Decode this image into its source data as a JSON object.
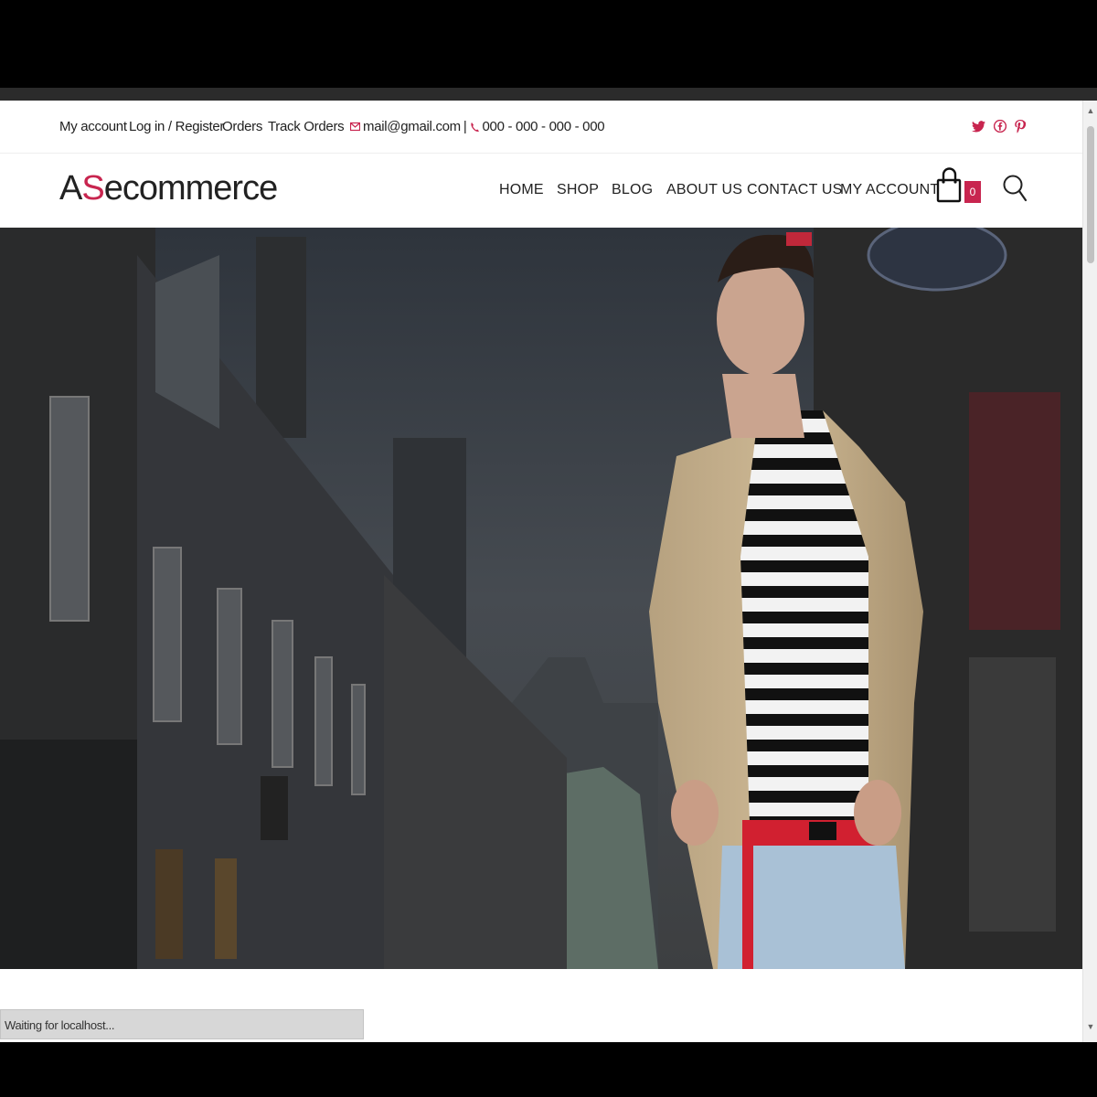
{
  "topbar": {
    "links": [
      "My account",
      "Log in / Register",
      "Orders",
      "Track Orders"
    ],
    "email": "mail@gmail.com",
    "separator": "|",
    "phone": "000 - 000 - 000 - 000",
    "social": [
      "twitter-icon",
      "facebook-icon",
      "pinterest-icon"
    ]
  },
  "header": {
    "logo_a": "A",
    "logo_s": "S",
    "logo_rest": "ecommerce",
    "nav": [
      "HOME",
      "SHOP",
      "BLOG",
      "ABOUT US",
      "CONTACT US",
      "MY ACCOUNT"
    ],
    "cart_count": "0"
  },
  "status_text": "Waiting for localhost...",
  "colors": {
    "accent": "#c8254f",
    "text": "#222222"
  }
}
